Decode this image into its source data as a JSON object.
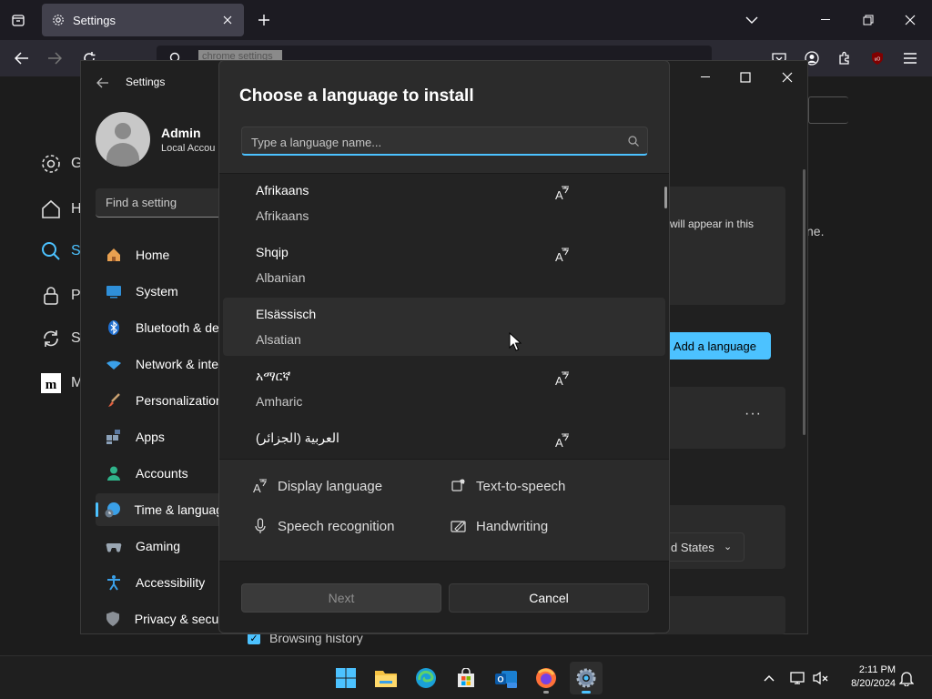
{
  "browser": {
    "tab_title": "Settings",
    "url_text": "chrome settings"
  },
  "page": {
    "side_items": [
      "G",
      "H",
      "S",
      "P",
      "S",
      "M"
    ],
    "right_text": "ne.",
    "browsing_history": "Browsing history"
  },
  "settings": {
    "title": "Settings",
    "user_name": "Admin",
    "user_sub": "Local Accou",
    "find_placeholder": "Find a setting",
    "nav": [
      {
        "label": "Home",
        "icon": "home-icon"
      },
      {
        "label": "System",
        "icon": "system-icon"
      },
      {
        "label": "Bluetooth & de",
        "icon": "bluetooth-icon"
      },
      {
        "label": "Network & inte",
        "icon": "network-icon"
      },
      {
        "label": "Personalization",
        "icon": "brush-icon"
      },
      {
        "label": "Apps",
        "icon": "apps-icon"
      },
      {
        "label": "Accounts",
        "icon": "accounts-icon"
      },
      {
        "label": "Time & languag",
        "icon": "time-language-icon"
      },
      {
        "label": "Gaming",
        "icon": "gaming-icon"
      },
      {
        "label": "Accessibility",
        "icon": "accessibility-icon"
      },
      {
        "label": "Privacy & secur",
        "icon": "shield-icon"
      }
    ],
    "card_text": "will appear in this",
    "add_language": "Add a language",
    "region_value": "d States"
  },
  "dialog": {
    "title": "Choose a language to install",
    "search_placeholder": "Type a language name...",
    "languages": [
      {
        "native": "Afrikaans",
        "english": "Afrikaans",
        "display_icon": true
      },
      {
        "native": "Shqip",
        "english": "Albanian",
        "display_icon": true
      },
      {
        "native": "Elsässisch",
        "english": "Alsatian",
        "display_icon": false
      },
      {
        "native": "አማርኛ",
        "english": "Amharic",
        "display_icon": true
      },
      {
        "native": "العربية (الجزائر)",
        "english": "",
        "display_icon": true
      }
    ],
    "legend": {
      "display_language": "Display language",
      "text_to_speech": "Text-to-speech",
      "speech_recognition": "Speech recognition",
      "handwriting": "Handwriting"
    },
    "next": "Next",
    "cancel": "Cancel"
  },
  "taskbar": {
    "time": "2:11 PM",
    "date": "8/20/2024"
  },
  "colors": {
    "accent": "#4cc2ff",
    "dialog_bg": "#2b2b2b",
    "taskbar_bg": "#1f1f1f"
  }
}
